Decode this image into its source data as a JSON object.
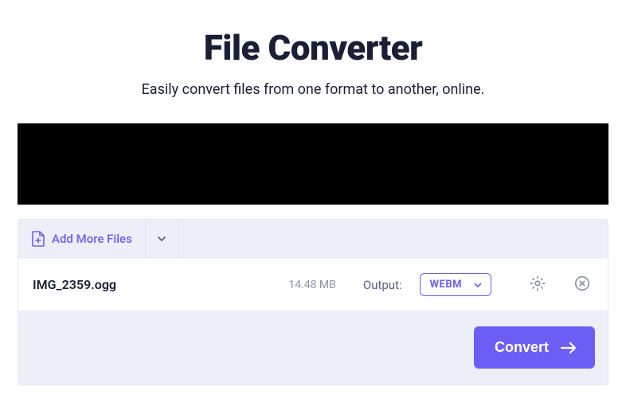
{
  "hero": {
    "title": "File Converter",
    "subtitle": "Easily convert files from one format to another, online."
  },
  "panel": {
    "add_more_label": "Add More Files",
    "file": {
      "name": "IMG_2359.ogg",
      "size": "14.48 MB",
      "output_label": "Output:",
      "format": "WEBM"
    },
    "convert_label": "Convert"
  }
}
